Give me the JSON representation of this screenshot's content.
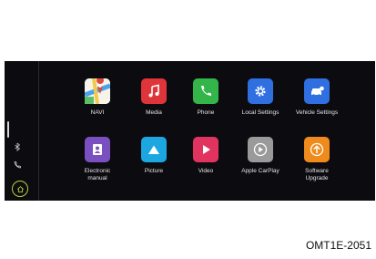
{
  "side_bar": {
    "icons": [
      "bluetooth-icon",
      "phone-icon",
      "home-icon"
    ]
  },
  "apps": [
    {
      "label": "NAVI",
      "icon": "map-icon",
      "color": "#e9a23a"
    },
    {
      "label": "Media",
      "icon": "music-note-icon",
      "color": "#e0343b"
    },
    {
      "label": "Phone",
      "icon": "phone-icon",
      "color": "#33b54a"
    },
    {
      "label": "Local Settings",
      "icon": "gear-icon",
      "color": "#2f6fe0"
    },
    {
      "label": "Vehicle Settings",
      "icon": "car-icon",
      "color": "#2f6fe0"
    },
    {
      "label": "Electronic\nmanual",
      "icon": "contact-book-icon",
      "color": "#7a4fc0"
    },
    {
      "label": "Picture",
      "icon": "mountain-picture-icon",
      "color": "#1da7e0"
    },
    {
      "label": "Video",
      "icon": "play-icon",
      "color": "#e03360"
    },
    {
      "label": "Apple CarPlay",
      "icon": "carplay-icon",
      "color": "#9a9a9a"
    },
    {
      "label": "Software\nUpgrade",
      "icon": "upgrade-icon",
      "color": "#ef8a1c"
    }
  ],
  "caption": "OMT1E-2051"
}
